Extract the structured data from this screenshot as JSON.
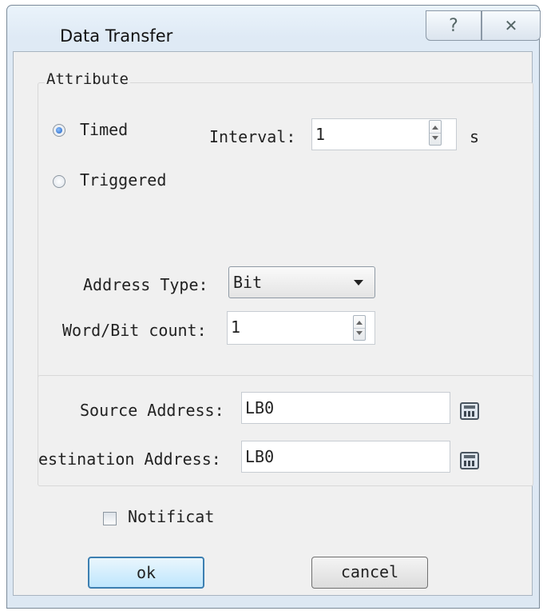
{
  "window": {
    "title": "Data Transfer",
    "help_glyph": "?",
    "close_glyph": "✕"
  },
  "attribute": {
    "legend": "Attribute",
    "timed_label": "Timed",
    "triggered_label": "Triggered",
    "selected": "timed",
    "interval_label": "Interval:",
    "interval_value": "1",
    "interval_unit": "s",
    "address_type_label": "Address Type:",
    "address_type_value": "Bit",
    "count_label": "Word/Bit count:",
    "count_value": "1"
  },
  "addresses": {
    "source_label": "Source Address:",
    "source_value": "LB0",
    "destination_label": "estination Address:",
    "destination_value": "LB0",
    "calculator_icon": "calculator-icon"
  },
  "notification": {
    "label": "Notificat",
    "checked": false
  },
  "buttons": {
    "ok_label": "ok",
    "cancel_label": "cancel"
  }
}
